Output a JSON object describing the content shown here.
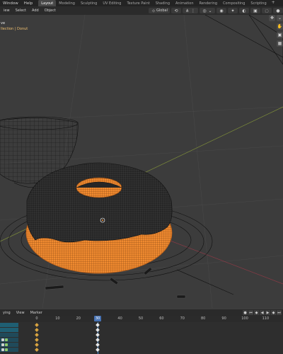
{
  "menu": [
    "Window",
    "Help"
  ],
  "workspaces": [
    "Layout",
    "Modeling",
    "Sculpting",
    "UV Editing",
    "Texture Paint",
    "Shading",
    "Animation",
    "Rendering",
    "Compositing",
    "Scripting"
  ],
  "workspace_add": "+",
  "header2": {
    "view_menus": [
      "iew",
      "Select",
      "Add",
      "Object"
    ],
    "orientation": "Global"
  },
  "viewport": {
    "mode_text": "ve",
    "scene_path": "llection | Donut"
  },
  "timeline": {
    "menus": [
      "ying",
      "View",
      "Marker"
    ],
    "ticks": [
      "0",
      "10",
      "20",
      "30",
      "40",
      "50",
      "60",
      "70",
      "80",
      "90",
      "100",
      "110"
    ],
    "current_frame": "30",
    "channels": [
      "",
      "",
      "",
      "",
      "",
      ""
    ]
  },
  "colors": {
    "accent": "#4772b3",
    "selection_orange": "#f08a30",
    "keyframe": "#d9a441"
  }
}
